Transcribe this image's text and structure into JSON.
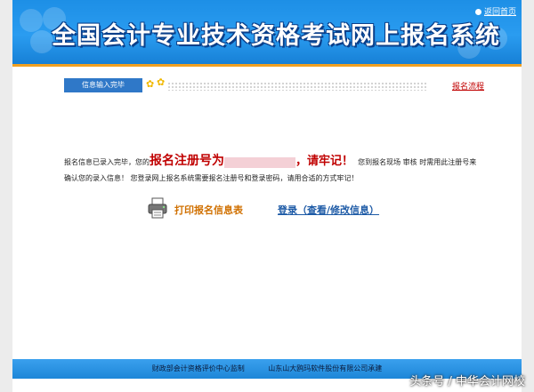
{
  "header": {
    "title": "全国会计专业技术资格考试网上报名系统",
    "back_home": "返回首页"
  },
  "status": {
    "tab_label": "信息输入完毕",
    "flow_link": "报名流程"
  },
  "message": {
    "part1": "报名信息已录入完毕，您的",
    "reg_no_label": "报名注册号为",
    "reg_no_value": "",
    "remember": "，请牢记！",
    "part2": "您到报名现场 审核 时需用此注册号来确认您的录入信息！ 您登录网上报名系统需要报名注册号和登录密码，请用合适的方式牢记！"
  },
  "actions": {
    "print_label": "打印报名信息表",
    "login_label": "登录（查看/修改信息）"
  },
  "footer": {
    "supervisor": "财政部会计资格评价中心监制",
    "undertaker": "山东山大鸥玛软件股份有限公司承建"
  },
  "watermark": "头条号 / 中华会计网校",
  "icons": [
    "home-icon",
    "star-icon",
    "printer-icon"
  ],
  "colors": {
    "header_blue": "#2a9cf0",
    "accent_orange": "#f0a020",
    "highlight_red": "#c00000",
    "link_blue": "#1d5aa6"
  }
}
